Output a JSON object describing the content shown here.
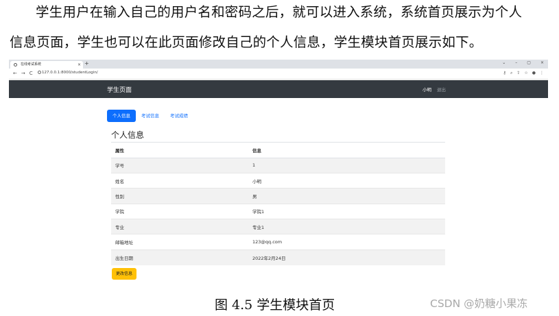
{
  "paragraph": {
    "line1": "学生用户在输入自己的用户名和密码之后，就可以进入系统，系统首页展示为个人",
    "line2": "信息页面，学生也可以在此页面修改自己的个人信息，学生模块首页展示如下。"
  },
  "screenshot": {
    "browser": {
      "tab_title": "在线考试系统",
      "tab_close": "×",
      "new_tab": "+",
      "window_controls": [
        "⌄",
        "–",
        "▢",
        "×"
      ],
      "nav_icons": [
        "←",
        "→",
        "C"
      ],
      "url": "127.0.0.1:8000/studentLogin/",
      "right_icons": [
        "⚷",
        "⌕",
        "⇪",
        "☆",
        "●",
        "⋮"
      ]
    },
    "navbar": {
      "brand": "学生页面",
      "user": "小明",
      "logout": "退出",
      "bg_color": "#343a40"
    },
    "tabs": [
      {
        "label": "个人信息",
        "active": true
      },
      {
        "label": "考试信息",
        "active": false
      },
      {
        "label": "考试成绩",
        "active": false
      }
    ],
    "section_title": "个人信息",
    "table": {
      "headers": [
        "属性",
        "信息"
      ],
      "rows": [
        [
          "学号",
          "1"
        ],
        [
          "姓名",
          "小明"
        ],
        [
          "性别",
          "男"
        ],
        [
          "学院",
          "学院1"
        ],
        [
          "专业",
          "专业1"
        ],
        [
          "邮箱地址",
          "123@qq.com"
        ],
        [
          "出生日期",
          "2022年2月24日"
        ]
      ]
    },
    "edit_button": "更改信息",
    "colors": {
      "primary": "#0d6efd",
      "warning": "#ffc107"
    }
  },
  "caption": "图 4.5  学生模块首页",
  "watermark": "CSDN @奶糖小果冻"
}
